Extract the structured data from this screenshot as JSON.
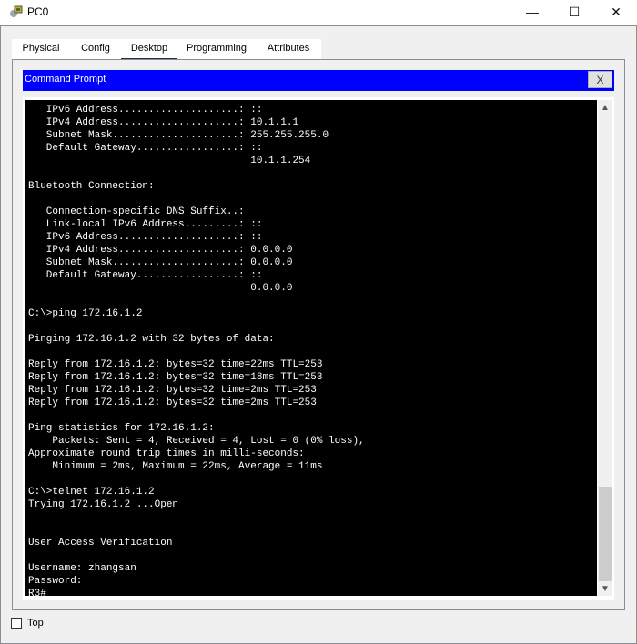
{
  "window": {
    "title": "PC0",
    "icon": "packet-tracer-pc-icon",
    "controls": {
      "minimize": "—",
      "maximize": "☐",
      "close": "✕"
    }
  },
  "tabs": [
    {
      "label": "Physical",
      "active": false
    },
    {
      "label": "Config",
      "active": false
    },
    {
      "label": "Desktop",
      "active": true
    },
    {
      "label": "Programming",
      "active": false
    },
    {
      "label": "Attributes",
      "active": false
    }
  ],
  "command_prompt": {
    "title": "Command Prompt",
    "close_label": "X",
    "lines": [
      "   IPv6 Address....................: ::",
      "   IPv4 Address....................: 10.1.1.1",
      "   Subnet Mask.....................: 255.255.255.0",
      "   Default Gateway.................: ::",
      "                                     10.1.1.254",
      "",
      "Bluetooth Connection:",
      "",
      "   Connection-specific DNS Suffix..: ",
      "   Link-local IPv6 Address.........: ::",
      "   IPv6 Address....................: ::",
      "   IPv4 Address....................: 0.0.0.0",
      "   Subnet Mask.....................: 0.0.0.0",
      "   Default Gateway.................: ::",
      "                                     0.0.0.0",
      "",
      "C:\\>ping 172.16.1.2",
      "",
      "Pinging 172.16.1.2 with 32 bytes of data:",
      "",
      "Reply from 172.16.1.2: bytes=32 time=22ms TTL=253",
      "Reply from 172.16.1.2: bytes=32 time=18ms TTL=253",
      "Reply from 172.16.1.2: bytes=32 time=2ms TTL=253",
      "Reply from 172.16.1.2: bytes=32 time=2ms TTL=253",
      "",
      "Ping statistics for 172.16.1.2:",
      "    Packets: Sent = 4, Received = 4, Lost = 0 (0% loss),",
      "Approximate round trip times in milli-seconds:",
      "    Minimum = 2ms, Maximum = 22ms, Average = 11ms",
      "",
      "C:\\>telnet 172.16.1.2",
      "Trying 172.16.1.2 ...Open",
      "",
      "",
      "User Access Verification",
      "",
      "Username: zhangsan",
      "Password: ",
      "R3#"
    ],
    "scroll_position": 0.95
  },
  "footer": {
    "top_checkbox_label": "Top",
    "top_checked": false
  },
  "colors": {
    "header_blue": "#0000ff",
    "terminal_bg": "#000000",
    "terminal_fg": "#ffffff",
    "active_tab_underline": "#1c2e4a"
  }
}
